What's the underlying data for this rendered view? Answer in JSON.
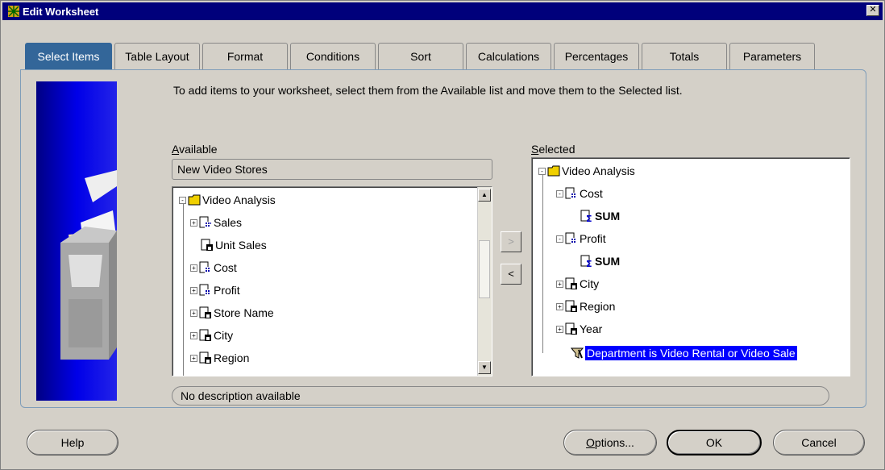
{
  "window": {
    "title": "Edit Worksheet",
    "close_glyph": "✕"
  },
  "tabs": [
    {
      "label": "Select Items",
      "active": true
    },
    {
      "label": "Table Layout"
    },
    {
      "label": "Format"
    },
    {
      "label": "Conditions"
    },
    {
      "label": "Sort"
    },
    {
      "label": "Calculations"
    },
    {
      "label": "Percentages"
    },
    {
      "label": "Totals"
    },
    {
      "label": "Parameters"
    }
  ],
  "instructions": "To add items to your worksheet, select them from the Available list and move them to the Selected list.",
  "available": {
    "label_prefix": "A",
    "label_rest": "vailable",
    "selector_value": "New Video Stores",
    "items": [
      {
        "label": "Video Analysis",
        "icon": "folder-icon"
      },
      {
        "label": "Sales",
        "icon": "measure-icon"
      },
      {
        "label": "Unit Sales",
        "icon": "item-icon"
      },
      {
        "label": "Cost",
        "icon": "measure-icon"
      },
      {
        "label": "Profit",
        "icon": "measure-icon"
      },
      {
        "label": "Store Name",
        "icon": "item-icon"
      },
      {
        "label": "City",
        "icon": "item-icon"
      },
      {
        "label": "Region",
        "icon": "item-icon"
      }
    ]
  },
  "selected": {
    "label_prefix": "S",
    "label_rest": "elected",
    "items": [
      {
        "label": "Video Analysis",
        "icon": "folder-icon"
      },
      {
        "label": "Cost",
        "icon": "measure-icon"
      },
      {
        "label": "SUM",
        "icon": "sum-icon"
      },
      {
        "label": "Profit",
        "icon": "measure-icon"
      },
      {
        "label": "SUM",
        "icon": "sum-icon"
      },
      {
        "label": "City",
        "icon": "item-icon"
      },
      {
        "label": "Region",
        "icon": "item-icon"
      },
      {
        "label": "Year",
        "icon": "item-icon"
      },
      {
        "label": "Department is Video Rental or Video Sale",
        "icon": "filter-icon",
        "selected": true
      }
    ]
  },
  "move_buttons": {
    "add": ">",
    "remove": "<"
  },
  "description": "No description available",
  "buttons": {
    "help": "Help",
    "options_prefix": "O",
    "options_rest": "ptions...",
    "ok": "OK",
    "cancel": "Cancel"
  },
  "colors": {
    "titlebar": "#00007b",
    "active_tab": "#336699",
    "selection": "#0000ff",
    "side_image_blue": "#0000ee"
  }
}
